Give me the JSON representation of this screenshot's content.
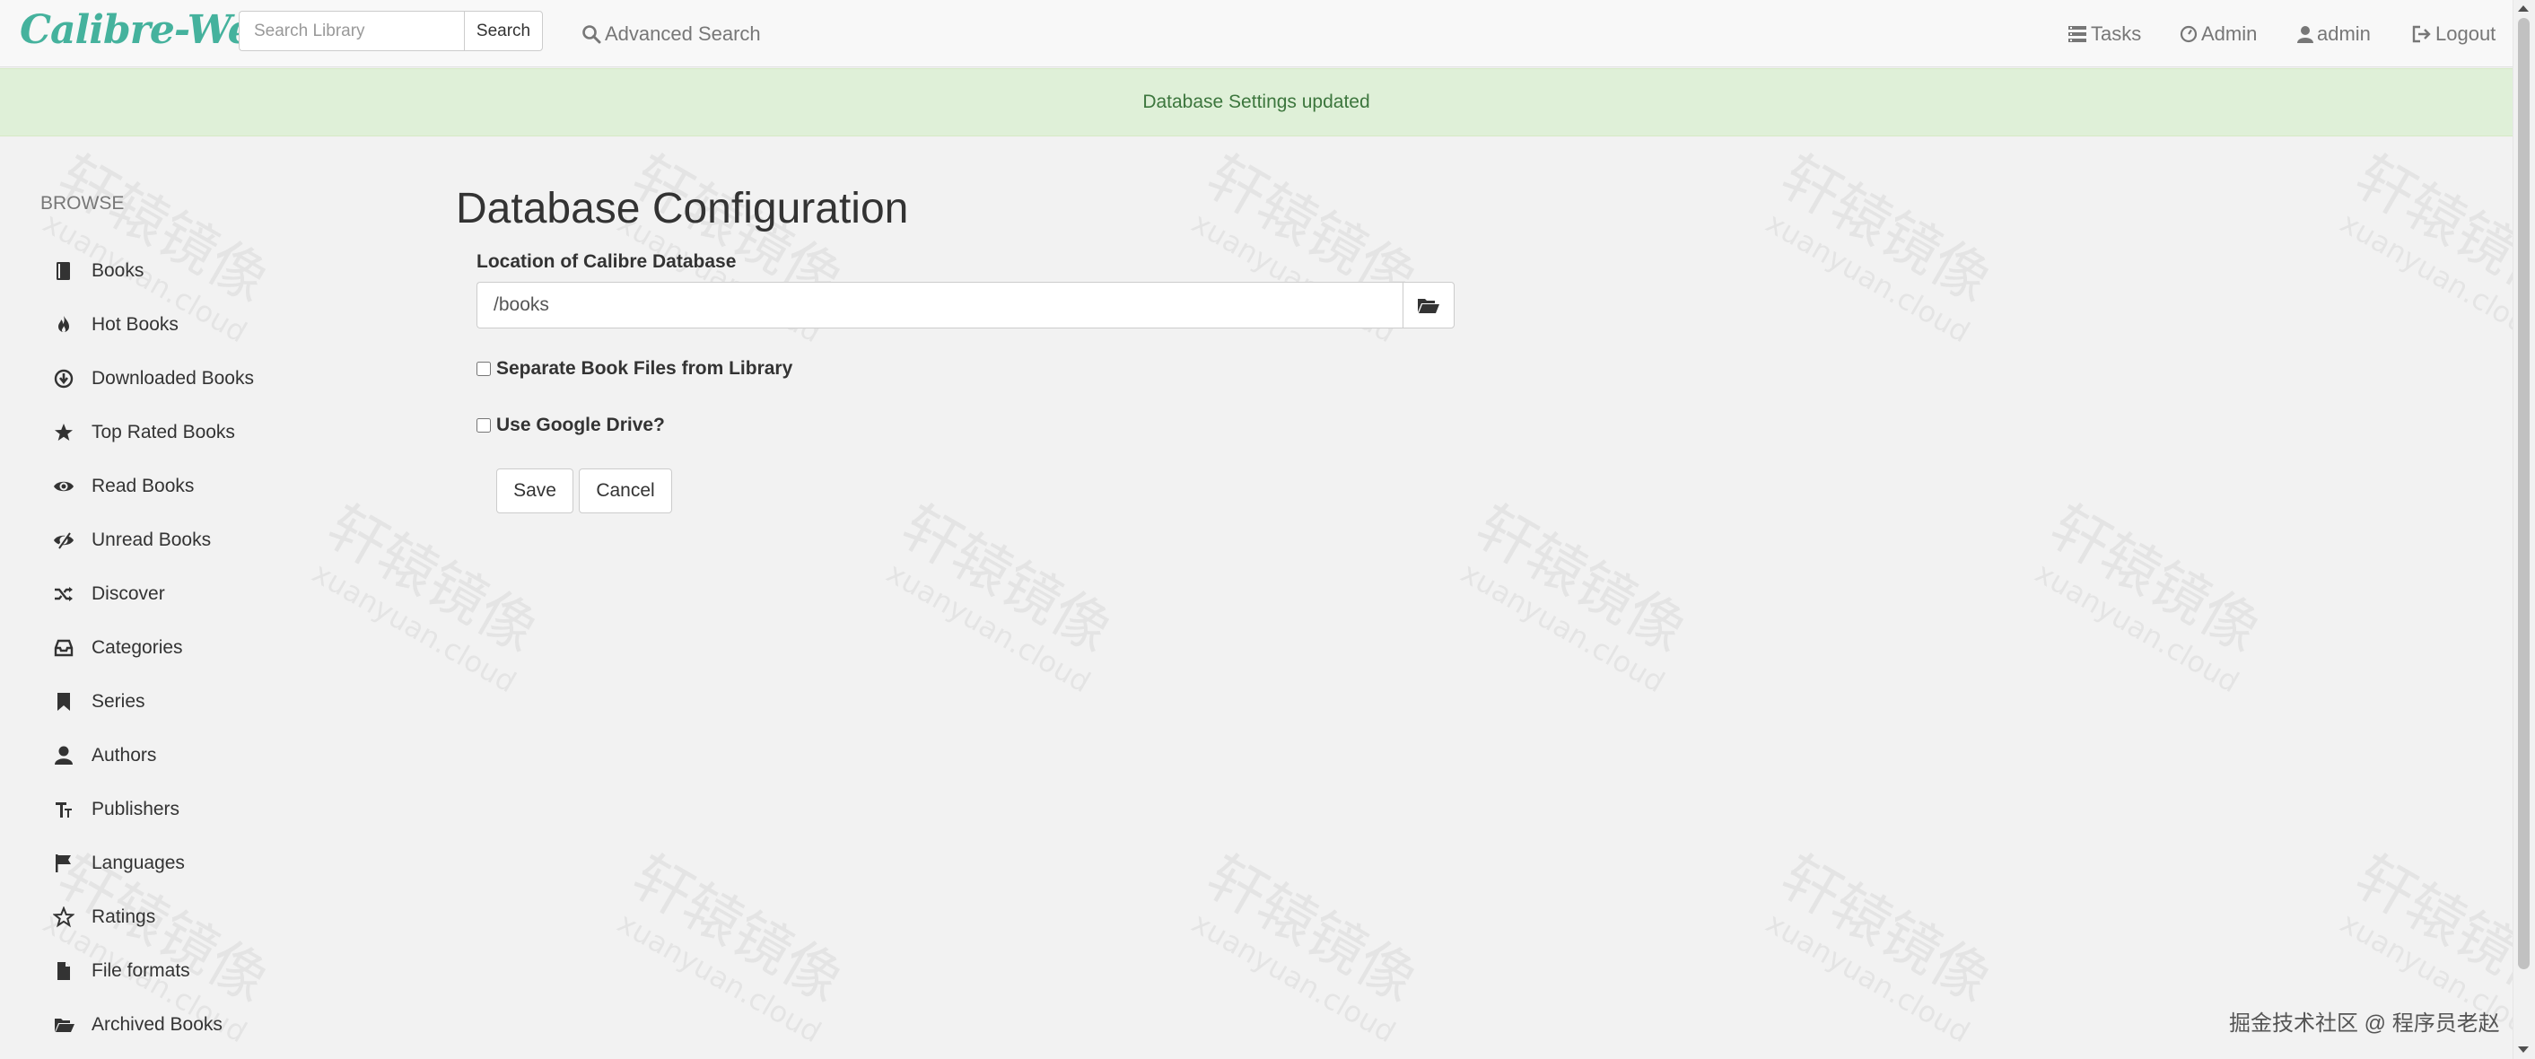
{
  "app": {
    "brand": "Calibre-Web"
  },
  "search": {
    "placeholder": "Search Library",
    "button_label": "Search"
  },
  "nav": {
    "advanced_search": "Advanced Search",
    "tasks": "Tasks",
    "admin": "Admin",
    "user": "admin",
    "logout": "Logout"
  },
  "alert": {
    "message": "Database Settings updated",
    "color": "#3c763d"
  },
  "sidebar": {
    "heading": "BROWSE",
    "items": [
      {
        "label": "Books",
        "icon": "book-icon"
      },
      {
        "label": "Hot Books",
        "icon": "fire-icon"
      },
      {
        "label": "Downloaded Books",
        "icon": "download-icon"
      },
      {
        "label": "Top Rated Books",
        "icon": "star-icon"
      },
      {
        "label": "Read Books",
        "icon": "eye-open-icon"
      },
      {
        "label": "Unread Books",
        "icon": "eye-closed-icon"
      },
      {
        "label": "Discover",
        "icon": "random-icon"
      },
      {
        "label": "Categories",
        "icon": "inbox-icon"
      },
      {
        "label": "Series",
        "icon": "bookmark-icon"
      },
      {
        "label": "Authors",
        "icon": "user-icon"
      },
      {
        "label": "Publishers",
        "icon": "text-size-icon"
      },
      {
        "label": "Languages",
        "icon": "flag-icon"
      },
      {
        "label": "Ratings",
        "icon": "star-empty-icon"
      },
      {
        "label": "File formats",
        "icon": "file-icon"
      },
      {
        "label": "Archived Books",
        "icon": "folder-open-icon"
      }
    ]
  },
  "main": {
    "title": "Database Configuration",
    "location_label": "Location of Calibre Database",
    "location_value": "/books",
    "separate_files_label": "Separate Book Files from Library",
    "separate_files_checked": false,
    "google_drive_label": "Use Google Drive?",
    "google_drive_checked": false,
    "save_label": "Save",
    "cancel_label": "Cancel"
  },
  "watermark": {
    "text_cn": "轩辕镜像",
    "text_en": "xuanyuan.cloud"
  },
  "footer": {
    "credit": "掘金技术社区 @ 程序员老赵"
  },
  "colors": {
    "brand": "#45b29d",
    "alert_bg": "#dff0d8",
    "page_bg": "#f2f2f2"
  }
}
